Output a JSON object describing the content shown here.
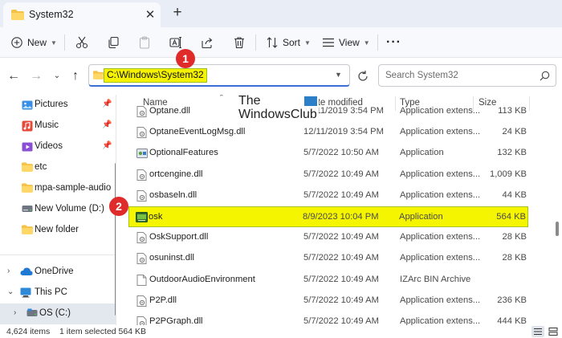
{
  "tab": {
    "title": "System32",
    "close_glyph": "✕",
    "new_tab_glyph": "+"
  },
  "toolbar": {
    "new_label": "New",
    "sort_label": "Sort",
    "view_label": "View",
    "more_glyph": "···"
  },
  "address": {
    "path": "C:\\Windows\\System32",
    "search_placeholder": "Search System32"
  },
  "callouts": {
    "one": "1",
    "two": "2"
  },
  "watermark": {
    "line1": "The",
    "line2": "WindowsClub"
  },
  "sidebar": {
    "items": [
      {
        "label": "Pictures",
        "icon": "pictures-icon",
        "pinned": true
      },
      {
        "label": "Music",
        "icon": "music-icon",
        "pinned": true
      },
      {
        "label": "Videos",
        "icon": "videos-icon",
        "pinned": true
      },
      {
        "label": "etc",
        "icon": "folder-icon",
        "pinned": false
      },
      {
        "label": "mpa-sample-audio",
        "icon": "folder-icon",
        "pinned": false
      },
      {
        "label": "New Volume (D:)",
        "icon": "drive-icon",
        "pinned": false
      },
      {
        "label": "New folder",
        "icon": "folder-icon",
        "pinned": false
      },
      {
        "label": "OneDrive",
        "icon": "cloud-icon",
        "pinned": false
      },
      {
        "label": "This PC",
        "icon": "pc-icon",
        "pinned": false
      },
      {
        "label": "OS (C:)",
        "icon": "drive-icon",
        "pinned": false
      }
    ]
  },
  "columns": {
    "name": "Name",
    "date": "Date modified",
    "type": "Type",
    "size": "Size"
  },
  "files": [
    {
      "name": "Optane.dll",
      "date": "12/11/2019 3:54 PM",
      "type": "Application extens...",
      "size": "113 KB",
      "icon": "dll-icon"
    },
    {
      "name": "OptaneEventLogMsg.dll",
      "date": "12/11/2019 3:54 PM",
      "type": "Application extens...",
      "size": "24 KB",
      "icon": "dll-icon"
    },
    {
      "name": "OptionalFeatures",
      "date": "5/7/2022 10:50 AM",
      "type": "Application",
      "size": "132 KB",
      "icon": "app-icon"
    },
    {
      "name": "ortcengine.dll",
      "date": "5/7/2022 10:49 AM",
      "type": "Application extens...",
      "size": "1,009 KB",
      "icon": "dll-icon"
    },
    {
      "name": "osbaseln.dll",
      "date": "5/7/2022 10:49 AM",
      "type": "Application extens...",
      "size": "44 KB",
      "icon": "dll-icon"
    },
    {
      "name": "osk",
      "date": "8/9/2023 10:04 PM",
      "type": "Application",
      "size": "564 KB",
      "icon": "keyboard-icon"
    },
    {
      "name": "OskSupport.dll",
      "date": "5/7/2022 10:49 AM",
      "type": "Application extens...",
      "size": "28 KB",
      "icon": "dll-icon"
    },
    {
      "name": "osuninst.dll",
      "date": "5/7/2022 10:49 AM",
      "type": "Application extens...",
      "size": "28 KB",
      "icon": "dll-icon"
    },
    {
      "name": "OutdoorAudioEnvironment",
      "date": "5/7/2022 10:49 AM",
      "type": "IZArc BIN Archive",
      "size": "",
      "icon": "file-icon"
    },
    {
      "name": "P2P.dll",
      "date": "5/7/2022 10:49 AM",
      "type": "Application extens...",
      "size": "236 KB",
      "icon": "dll-icon"
    },
    {
      "name": "P2PGraph.dll",
      "date": "5/7/2022 10:49 AM",
      "type": "Application extens...",
      "size": "444 KB",
      "icon": "dll-icon"
    }
  ],
  "status": {
    "count": "4,624 items",
    "selected": "1 item selected  564 KB"
  }
}
